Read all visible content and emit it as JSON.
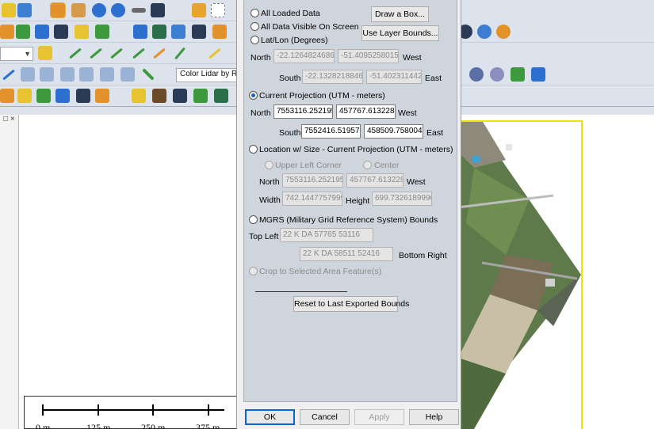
{
  "toolbar": {
    "lidar_combo_label": "Color Lidar by R",
    "colors": {
      "icon_blue": "#2d6fcf",
      "icon_orange": "#e3922b",
      "icon_green": "#3c9a3c",
      "icon_yellow": "#e8c331",
      "icon_red": "#d43c3c",
      "toolbar_bg": "#dde3ec"
    }
  },
  "left_panel": {
    "close_glyph": "□ ×"
  },
  "scalebar": {
    "labels": [
      "0 m",
      "125 m",
      "250 m",
      "375 m"
    ]
  },
  "dialog": {
    "all_loaded_data": "All Loaded Data",
    "all_data_visible": "All Data Visible On Screen",
    "latlon": "Lat/Lon (Degrees)",
    "draw_box": "Draw a Box...",
    "use_layer_bounds": "Use Layer Bounds...",
    "latlon_north_label": "North",
    "latlon_north_val1": "-22.12648246863",
    "latlon_north_val2": "-51.40952580159",
    "latlon_west_label": "West",
    "latlon_south_label": "South",
    "latlon_south_val1": "-22.13282188462",
    "latlon_south_val2": "-51.40231144200",
    "latlon_east_label": "East",
    "current_projection": "Current Projection (UTM - meters)",
    "cp_north_label": "North",
    "cp_north_val1": "7553116.252195",
    "cp_north_val2": "457767.6132288",
    "cp_west_label": "West",
    "cp_south_label": "South",
    "cp_south_val1": "7552416.519576",
    "cp_south_val2": "458509.7580046",
    "cp_east_label": "East",
    "location_size": "Location w/ Size - Current Projection (UTM - meters)",
    "upper_left_corner": "Upper Left Corner",
    "center": "Center",
    "ls_north_label": "North",
    "ls_north_val1": "7553116.252195",
    "ls_north_val2": "457767.6132288",
    "ls_west_label": "West",
    "ls_width_label": "Width",
    "ls_width_val": "742.1447757999",
    "ls_height_label": "Height",
    "ls_height_val": "699.7326189996",
    "mgrs": "MGRS (Military Grid Reference System) Bounds",
    "top_left_label": "Top Left",
    "top_left_val": "22 K DA 57765 53116",
    "bottom_right_val": "22 K DA 58511 52416",
    "bottom_right_label": "Bottom Right",
    "crop_selected": "Crop to Selected Area Feature(s)",
    "reset_bounds": "Reset to Last Exported Bounds",
    "ok": "OK",
    "cancel": "Cancel",
    "apply": "Apply",
    "help": "Help"
  }
}
